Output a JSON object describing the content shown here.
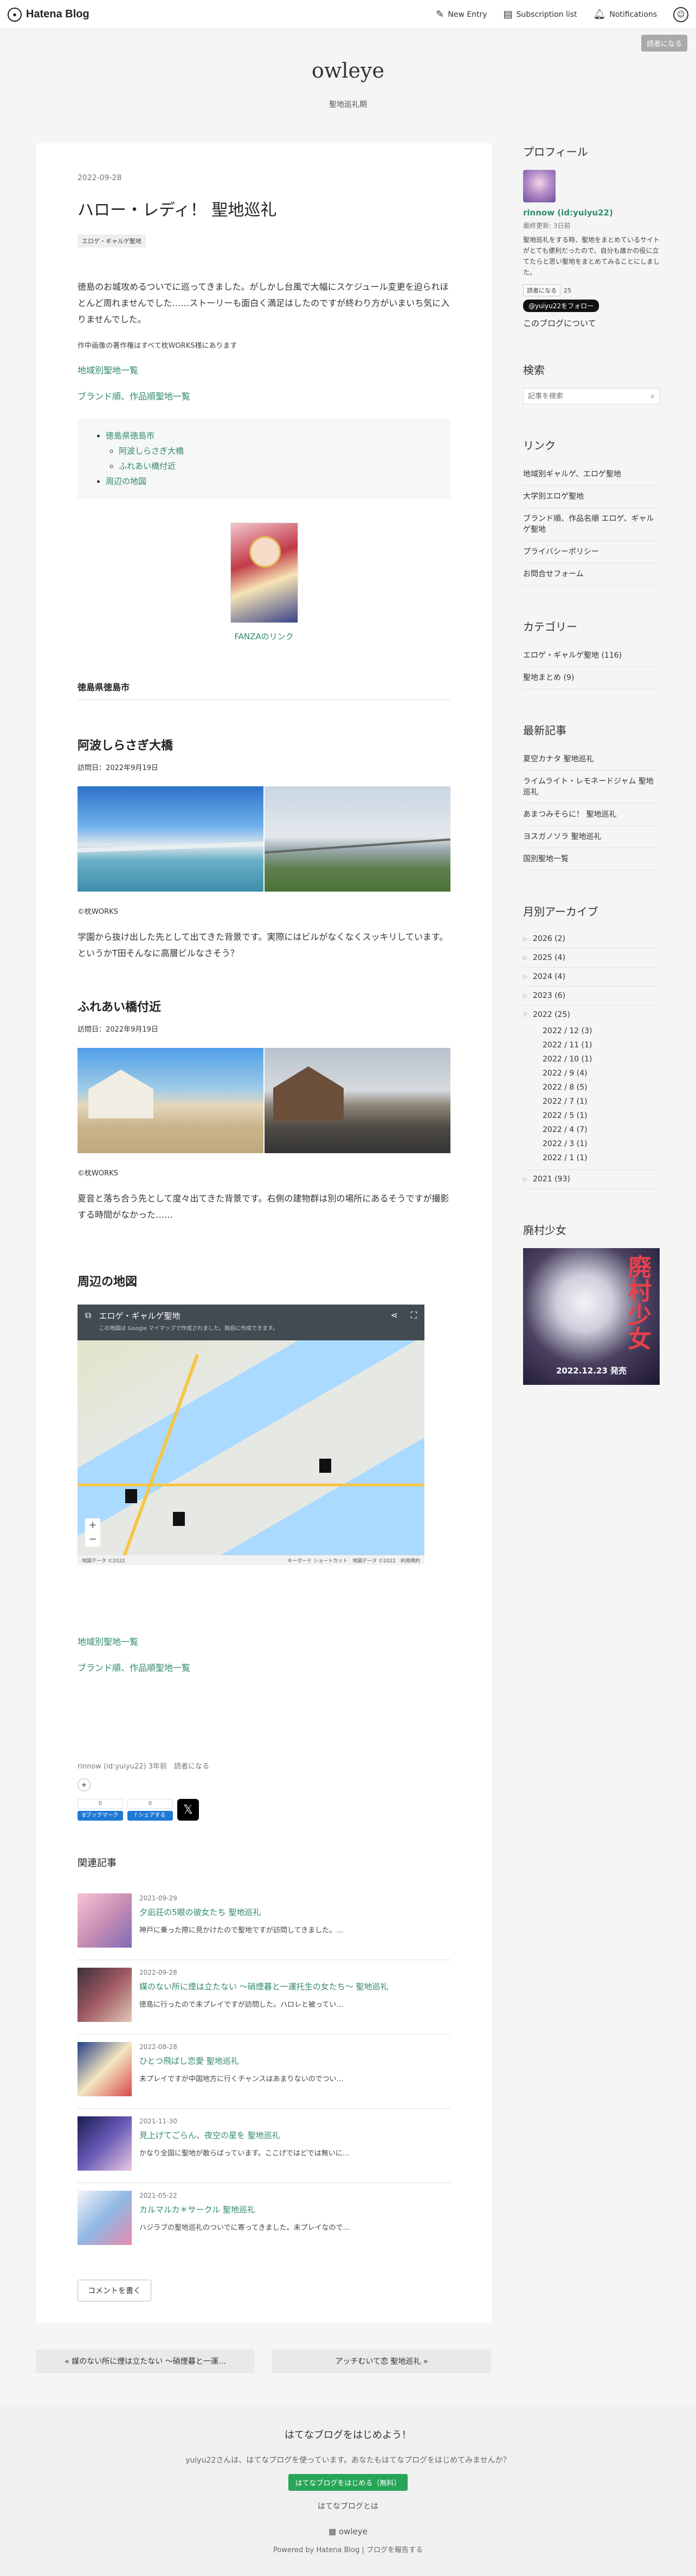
{
  "header": {
    "logo": "Hatena Blog",
    "new_entry": "New Entry",
    "subscription_list": "Subscription list",
    "notifications": "Notifications",
    "reader_button": "読者になる"
  },
  "blog": {
    "title": "owleye",
    "description": "聖地巡礼期"
  },
  "article": {
    "date": "2022-09-28",
    "title": "ハロー・レディ！ 聖地巡礼",
    "category": "エロゲ・ギャルゲ聖地",
    "lead": "徳島のお城攻めるついでに巡ってきました。がしかし台風で大幅にスケジュール変更を迫られほとんど周れませんでした……ストーリーも面白く満足はしたのですが終わり方がいまいち気に入りませんでした。",
    "copyright_note": "作中画像の著作権はすべて枕WORKS様にあります",
    "link_area": "地域別聖地一覧",
    "link_brand": "ブランド順、作品順聖地一覧",
    "toc": {
      "l1": "徳島県徳島市",
      "l1a": "阿波しらさぎ大橋",
      "l1b": "ふれあい橋付近",
      "l2": "周辺の地図"
    },
    "fanza_link": "FANZAのリンク",
    "section_city": "徳島県徳島市",
    "spot1": {
      "title": "阿波しらさぎ大橋",
      "visit": "訪問日：2022年9月19日",
      "credit": "©枕WORKS",
      "body": "学園から抜け出した先として出てきた背景です。実際にはビルがなくなくスッキリしています。というかT田そんなに高層ビルなさそう？"
    },
    "spot2": {
      "title": "ふれあい橋付近",
      "visit": "訪問日：2022年9月19日",
      "credit": "©枕WORKS",
      "body": "夏音と落ち合う先として度々出てきた背景です。右側の建物群は別の場所にあるそうですが撮影する時間がなかった……"
    },
    "map_heading": "周辺の地図",
    "map": {
      "title": "エロゲ・ギャルゲ聖地",
      "subtitle": "この地図は Google マイマップで作成されました。独自に作成できます。",
      "footer_left": "地図データ ©2022",
      "footer_right": "キーボード ショートカット　地図データ ©2022　利用規約"
    },
    "bottom_link_area": "地域別聖地一覧",
    "bottom_link_brand": "ブランド順、作品順聖地一覧",
    "byline": "rinnow (id:yuiyu22) 3年前　読者になる",
    "share": {
      "hatena_count": "0",
      "hatena_label": "Bブックマーク",
      "fb_count": "0",
      "fb_label": "f シェアする",
      "x": "𝕏"
    },
    "related_heading": "関連記事",
    "related": [
      {
        "date": "2021-09-29",
        "title": "夕凪荘の5眼の彼女たち 聖地巡礼",
        "snippet": "神戸に乗った際に見かけたので聖地ですが訪問してきました。…"
      },
      {
        "date": "2022-09-28",
        "title": "媒のない所に煙は立たない ～硝煙暮と一運托生の女たち～ 聖地巡礼",
        "snippet": "徳島に行ったので未プレイですが訪問した。ハロレと被ってい…"
      },
      {
        "date": "2022-08-28",
        "title": "ひとつ飛ばし恋愛 聖地巡礼",
        "snippet": "未プレイですが中国地方に行くチャンスはあまりないのでつい…"
      },
      {
        "date": "2021-11-30",
        "title": "見上げてごらん、夜空の星を 聖地巡礼",
        "snippet": "かなり全国に聖地が散らばっています。ここげではどでは無いに…"
      },
      {
        "date": "2021-05-22",
        "title": "カルマルカ＊サークル 聖地巡礼",
        "snippet": "ハジラブの聖地巡礼のついでに寄ってきました。未プレイなので…"
      }
    ],
    "comment_button": "コメントを書く"
  },
  "sidebar": {
    "profile_h": "プロフィール",
    "name": "rinnow (id:yuiyu22)",
    "updated": "最終更新: 3日前",
    "desc": "聖地巡礼をする時、聖地をまとめているサイトがとても便利だったので、自分も誰かの役に立てたらと思い聖地をまとめてみることにしました。",
    "reader_count_label": "読者になる",
    "reader_count": "25",
    "follow": "@yuiyu22をフォロー",
    "about": "このブログについて",
    "search_h": "検索",
    "search_placeholder": "記事を検索",
    "links_h": "リンク",
    "links": [
      "地域別ギャルゲ、エロゲ聖地",
      "大学別エロゲ聖地",
      "ブランド順、作品名順 エロゲ、ギャルゲ聖地",
      "プライバシーポリシー",
      "お問合せフォーム"
    ],
    "cat_h": "カテゴリー",
    "categories": [
      "エロゲ・ギャルゲ聖地 (116)",
      "聖地まとめ (9)"
    ],
    "recent_h": "最新記事",
    "recent": [
      "夏空カナタ 聖地巡礼",
      "ライムライト・レモネードジャム 聖地巡礼",
      "あまつみそらに！ 聖地巡礼",
      "ヨスガノソラ 聖地巡礼",
      "国別聖地一覧"
    ],
    "archive_h": "月別アーカイブ",
    "archive_years": [
      "2026 (2)",
      "2025 (4)",
      "2024 (4)",
      "2023 (6)"
    ],
    "archive_open_year": "2022 (25)",
    "archive_months": [
      "2022 / 12 (3)",
      "2022 / 11 (1)",
      "2022 / 10 (1)",
      "2022 / 9 (4)",
      "2022 / 8 (5)",
      "2022 / 7 (1)",
      "2022 / 5 (1)",
      "2022 / 4 (7)",
      "2022 / 3 (1)",
      "2022 / 1 (1)"
    ],
    "archive_last": "2021 (93)",
    "ad_h": "廃村少女",
    "ad_title": "廃村少女",
    "ad_sub": "2022.12.23 発売"
  },
  "pager": {
    "prev": "« 媒のない所に煙は立たない ～硝煙暮と一運…",
    "next": "アッチむいて恋 聖地巡礼 »"
  },
  "footer": {
    "heading": "はてなブログをはじめよう！",
    "message": "yuiyu22さんは、はてなブログを使っています。あなたもはてなブログをはじめてみませんか？",
    "button": "はてなブログをはじめる（無料）",
    "about": "はてなブログとは",
    "blog_name": "owleye",
    "powered": "Powered by Hatena Blog | ブログを報告する"
  }
}
